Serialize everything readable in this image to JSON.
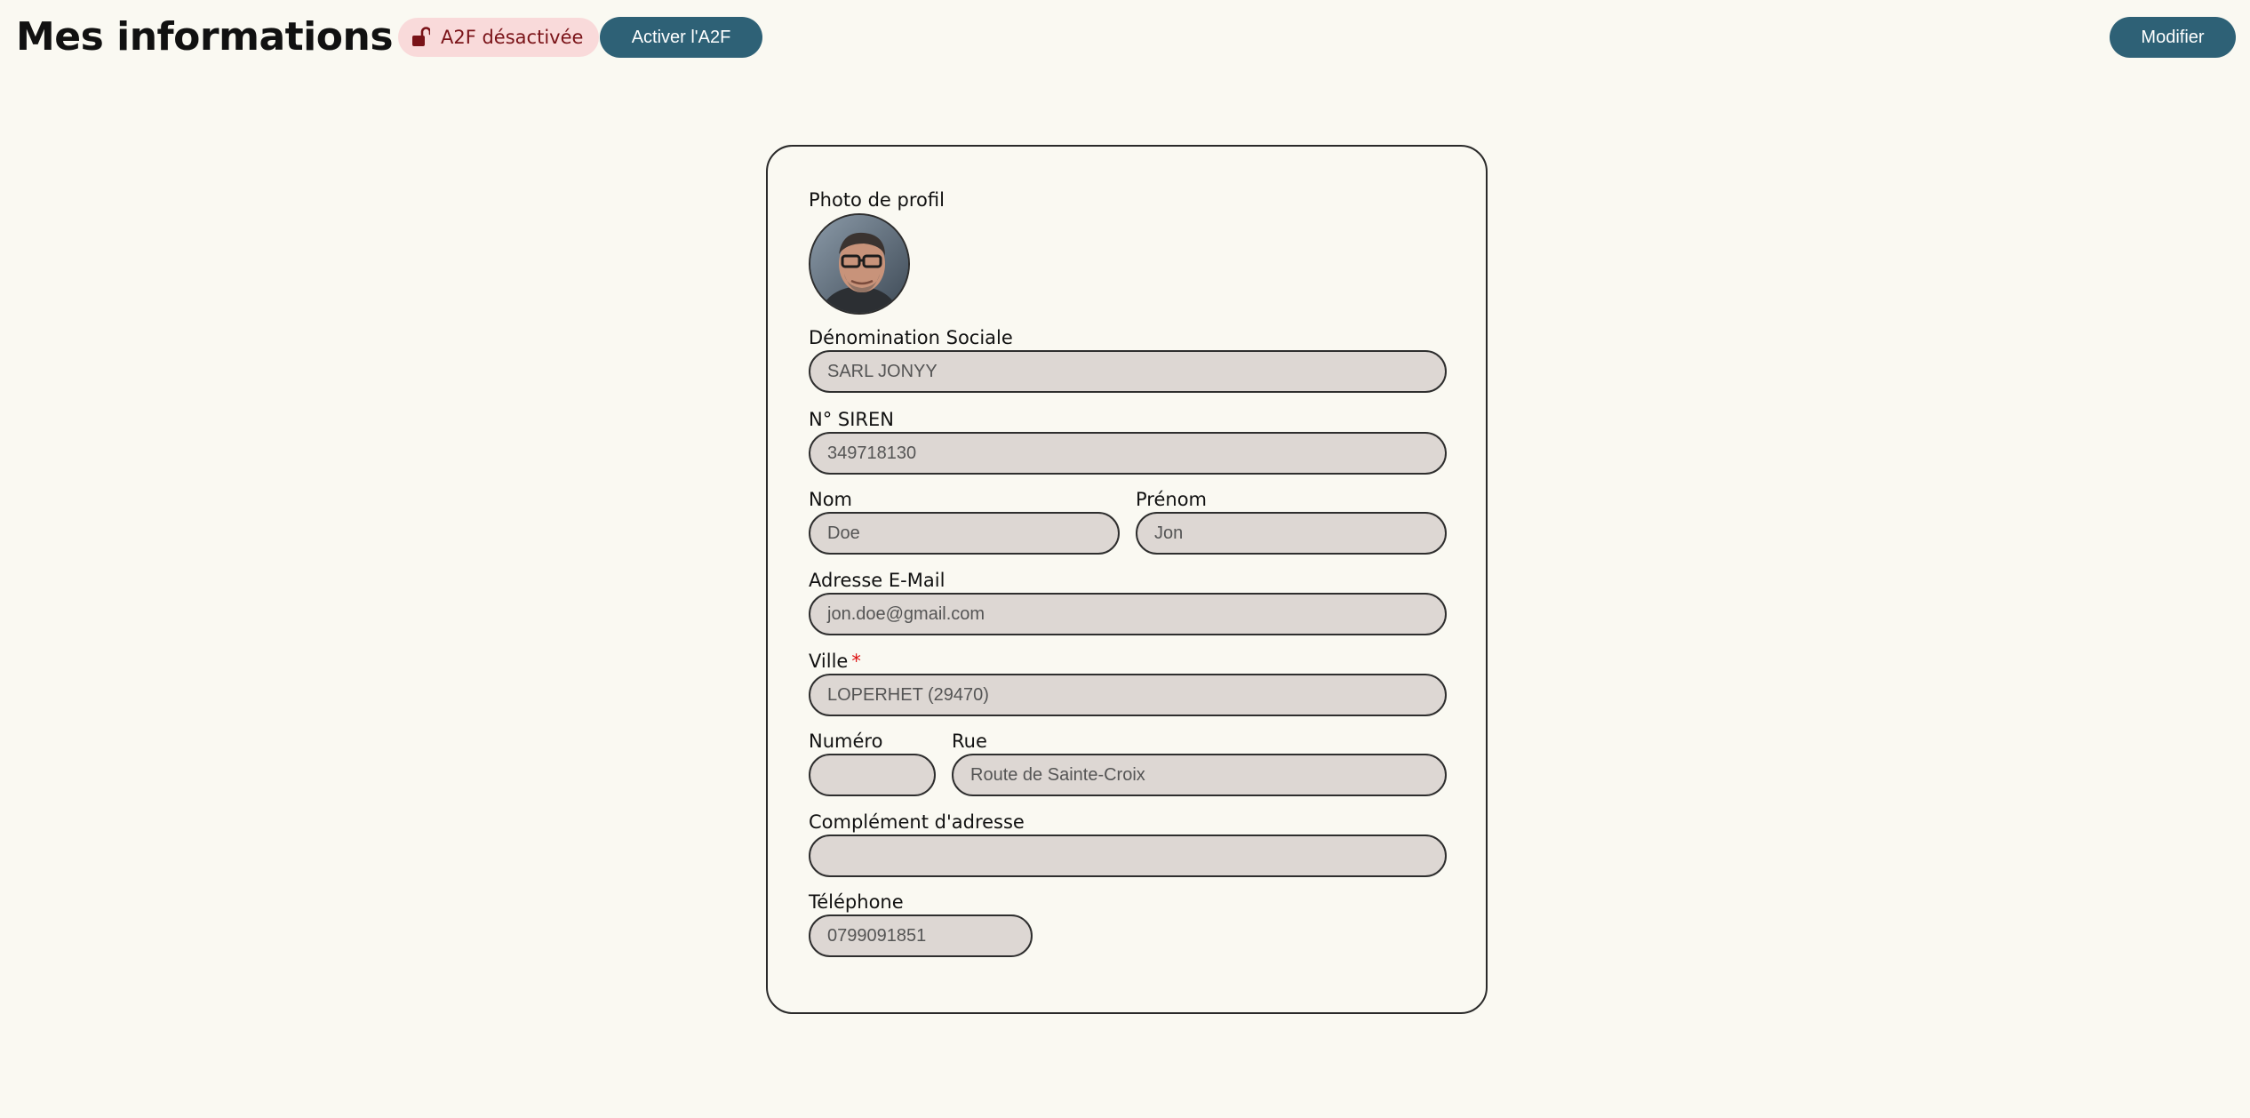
{
  "header": {
    "title": "Mes informations",
    "a2f_status": "A2F désactivée",
    "activate_label": "Activer l'A2F",
    "modify_label": "Modifier"
  },
  "form": {
    "photo_label": "Photo de profil",
    "denomination": {
      "label": "Dénomination Sociale",
      "value": "SARL JONYY"
    },
    "siren": {
      "label": "N° SIREN",
      "value": "349718130"
    },
    "nom": {
      "label": "Nom",
      "value": "Doe"
    },
    "prenom": {
      "label": "Prénom",
      "value": "Jon"
    },
    "email": {
      "label": "Adresse E-Mail",
      "value": "jon.doe@gmail.com"
    },
    "ville": {
      "label": "Ville",
      "required_mark": "*",
      "value": "LOPERHET (29470)"
    },
    "numero": {
      "label": "Numéro",
      "value": ""
    },
    "rue": {
      "label": "Rue",
      "value": "Route de Sainte-Croix"
    },
    "complement": {
      "label": "Complément d'adresse",
      "value": ""
    },
    "telephone": {
      "label": "Téléphone",
      "value": "0799091851"
    }
  },
  "icons": {
    "a2f_badge": "unlocked-padlock-icon"
  },
  "colors": {
    "background": "#faf9f2",
    "primary_button": "#2e6176",
    "badge_bg": "#f9dada",
    "badge_text": "#7a1318",
    "input_bg": "#ddd7d3",
    "required": "#dd1111"
  }
}
